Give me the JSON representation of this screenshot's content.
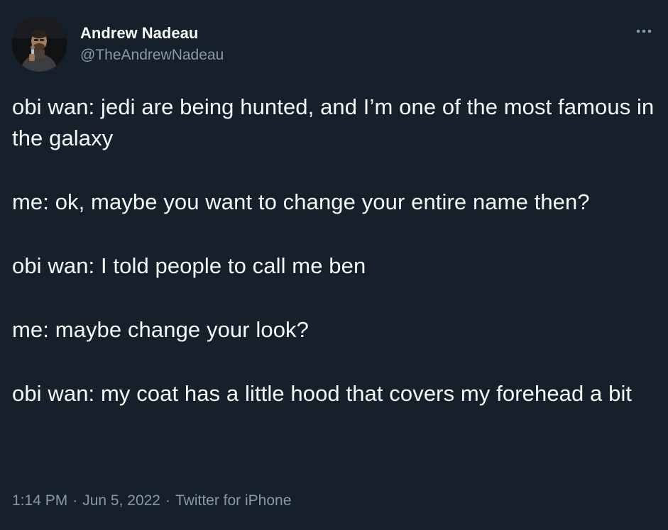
{
  "tweet": {
    "author": {
      "display_name": "Andrew Nadeau",
      "handle": "@TheAndrewNadeau",
      "avatar_icon": "avatar-photo"
    },
    "more_icon": "more-horizontal-icon",
    "paragraphs": [
      "obi wan: jedi are being hunted, and I’m one of the most famous in the galaxy",
      "me: ok, maybe you want to change your entire name then?",
      "obi wan: I told people to call me ben",
      "me: maybe change your look?",
      "obi wan: my coat has a little hood that covers my forehead a bit"
    ],
    "time": "1:14 PM",
    "separator": "·",
    "date": "Jun 5, 2022",
    "source": "Twitter for iPhone"
  },
  "colors": {
    "background": "#15202b",
    "primary_text": "#f7f9f9",
    "secondary_text": "#8b98a5"
  }
}
